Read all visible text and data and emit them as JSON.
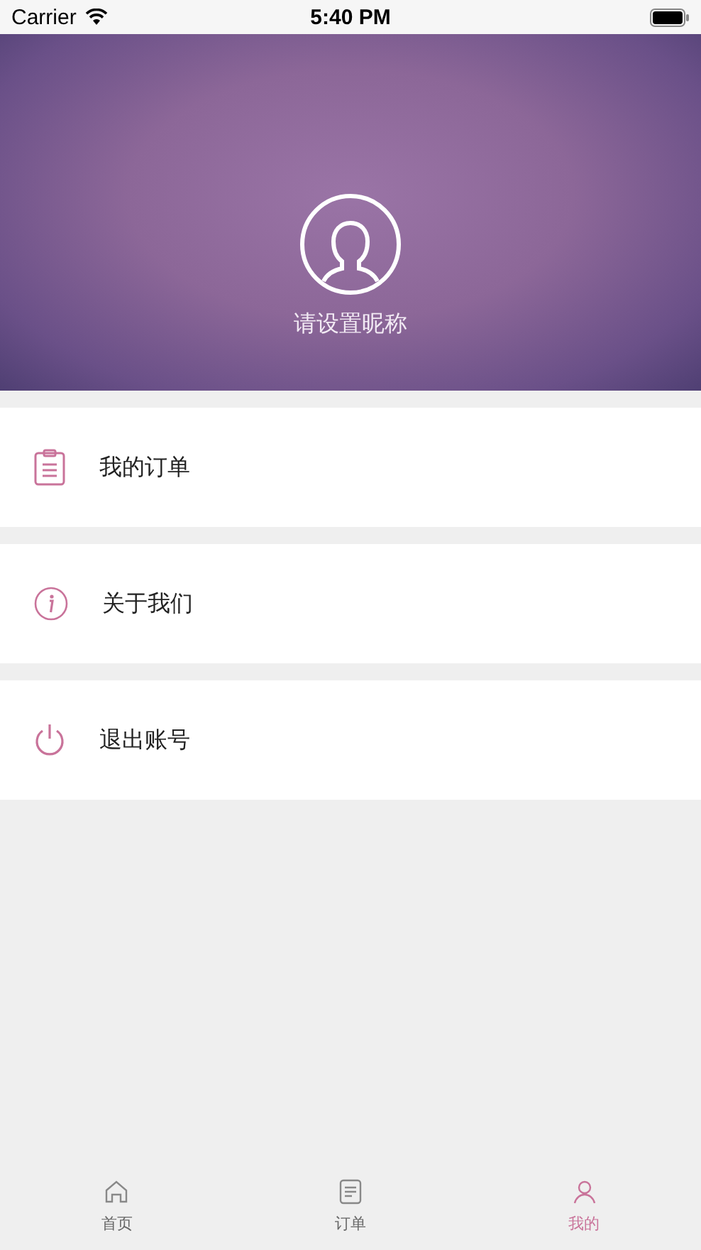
{
  "status_bar": {
    "carrier": "Carrier",
    "time": "5:40 PM"
  },
  "profile": {
    "nickname": "请设置昵称"
  },
  "menu": [
    {
      "kind": "orders",
      "label": "我的订单"
    },
    {
      "kind": "about",
      "label": "关于我们"
    },
    {
      "kind": "logout",
      "label": "退出账号"
    }
  ],
  "tab_bar": [
    {
      "kind": "home",
      "label": "首页",
      "selected": false
    },
    {
      "kind": "orders",
      "label": "订单",
      "selected": false
    },
    {
      "kind": "me",
      "label": "我的",
      "selected": true
    }
  ]
}
